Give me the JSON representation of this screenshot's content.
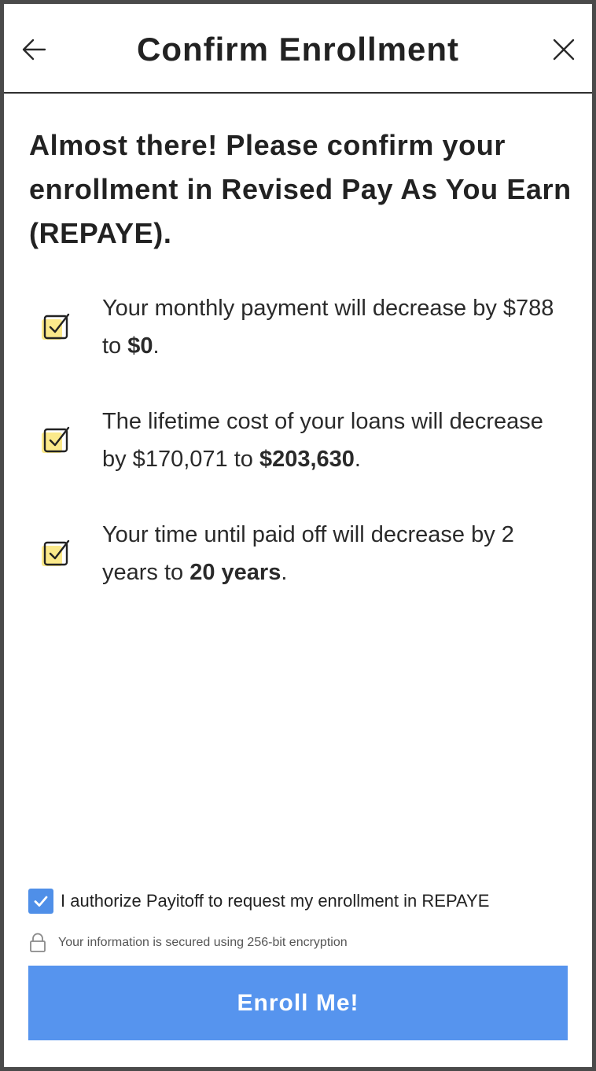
{
  "header": {
    "title": "Confirm Enrollment",
    "back_icon": "arrow-left-icon",
    "close_icon": "close-icon"
  },
  "headline": "Almost there! Please confirm your enrollment in Revised Pay As You Earn (REPAYE).",
  "benefits": [
    {
      "icon": "checklist-check-icon",
      "text": "Your monthly payment will decrease by $788 to ",
      "emphasis": "$0",
      "suffix": "."
    },
    {
      "icon": "checklist-check-icon",
      "text": "The lifetime cost of your loans will decrease by $170,071 to ",
      "emphasis": "$203,630",
      "suffix": "."
    },
    {
      "icon": "checklist-check-icon",
      "text": "Your time until paid off will decrease by 2 years to ",
      "emphasis": "20 years",
      "suffix": "."
    }
  ],
  "authorization": {
    "checked": true,
    "label": "I authorize Payitoff to request my enrollment in REPAYE"
  },
  "security": {
    "icon": "lock-icon",
    "text": "Your information is secured using 256-bit encryption"
  },
  "cta": {
    "label": "Enroll Me!"
  },
  "colors": {
    "accent": "#5694ee",
    "highlight": "#fbe98a",
    "text": "#222222"
  }
}
